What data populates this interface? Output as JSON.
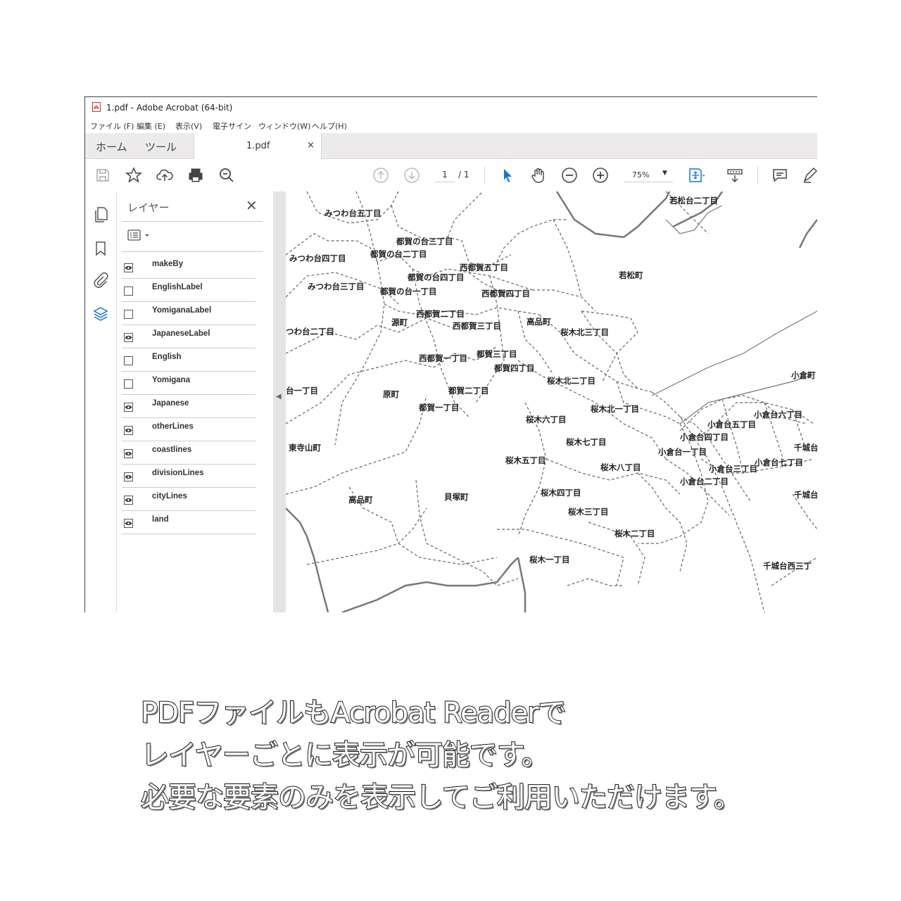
{
  "window": {
    "title": "1.pdf - Adobe Acrobat (64-bit)"
  },
  "menu": [
    "ファイル (F)",
    "編集 (E)",
    "表示(V)",
    "電子サイン",
    "ウィンドウ(W)",
    "ヘルプ(H)"
  ],
  "tabs": {
    "home": "ホーム",
    "tools": "ツール",
    "document": "1.pdf",
    "close": "×"
  },
  "toolbar": {
    "page_current": "1",
    "page_total": "/ 1",
    "zoom": "75%",
    "zoom_caret": "▼"
  },
  "layers_panel": {
    "title": "レイヤー",
    "close": "✕",
    "layers": [
      {
        "name": "makeBy",
        "visible": true
      },
      {
        "name": "EnglishLabel",
        "visible": false
      },
      {
        "name": "YomiganaLabel",
        "visible": false
      },
      {
        "name": "JapaneseLabel",
        "visible": true
      },
      {
        "name": "English",
        "visible": false
      },
      {
        "name": "Yomigana",
        "visible": false
      },
      {
        "name": "Japanese",
        "visible": true
      },
      {
        "name": "otherLines",
        "visible": true
      },
      {
        "name": "coastlines",
        "visible": true
      },
      {
        "name": "divisionLines",
        "visible": true
      },
      {
        "name": "cityLines",
        "visible": true
      },
      {
        "name": "land",
        "visible": true
      }
    ]
  },
  "map_labels": [
    "みつわ台五丁目",
    "若松台二丁目",
    "都賀の台三丁目",
    "都賀の台二丁目",
    "みつわ台四丁目",
    "西都賀五丁目",
    "都賀の台四丁目",
    "若松町",
    "みつわ台三丁目",
    "都賀の台一丁目",
    "西都賀四丁目",
    "西都賀二丁目",
    "源町",
    "高品町",
    "西都賀三丁目",
    "つわ台二丁目",
    "桜木北三丁目",
    "都賀三丁目",
    "西都賀一丁目",
    "都賀四丁目",
    "小倉町",
    "桜木北二丁目",
    "台一丁目",
    "原町",
    "都賀二丁目",
    "都賀一丁目",
    "桜木北一丁目",
    "小倉台六丁目",
    "桜木六丁目",
    "小倉台五丁目",
    "小倉台四丁目",
    "桜木七丁目",
    "東寺山町",
    "千城台",
    "小倉台一丁目",
    "桜木五丁目",
    "小倉台七丁目",
    "桜木八丁目",
    "小倉台三丁目",
    "小倉台二丁目",
    "桜木四丁目",
    "千城台",
    "高品町",
    "貝塚町",
    "桜木三丁目",
    "桜木二丁目",
    "桜木一丁目",
    "千城台西三丁"
  ],
  "caption": [
    "PDFファイルもAcrobat Readerで",
    "レイヤーごとに表示が可能です。",
    "必要な要素のみを表示してご利用いただけます。"
  ],
  "colors": {
    "acrobat_red": "#d32f2f",
    "accent_blue": "#1473e6",
    "map_line": "#666666"
  }
}
